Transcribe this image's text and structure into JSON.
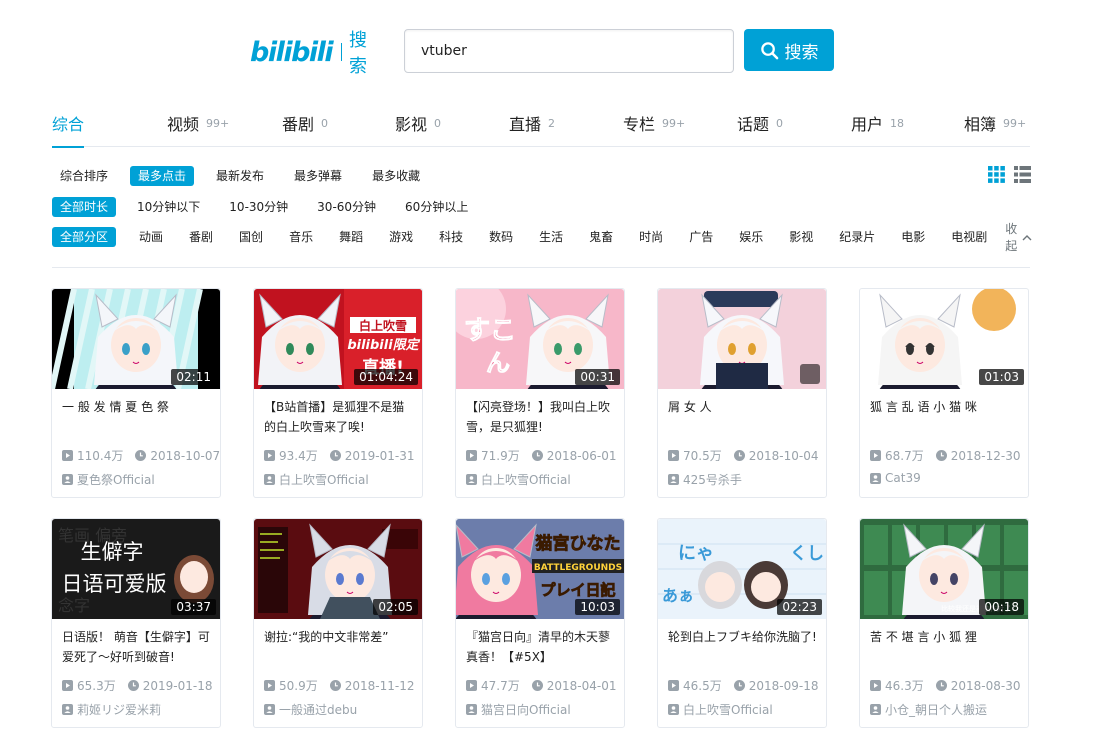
{
  "header": {
    "logo_text": "bilibili",
    "logo_sub": "搜索",
    "search_value": "vtuber",
    "search_button": "搜索"
  },
  "type_tabs": [
    {
      "label": "综合",
      "count": ""
    },
    {
      "label": "视频",
      "count": "99+"
    },
    {
      "label": "番剧",
      "count": "0"
    },
    {
      "label": "影视",
      "count": "0"
    },
    {
      "label": "直播",
      "count": "2"
    },
    {
      "label": "专栏",
      "count": "99+"
    },
    {
      "label": "话题",
      "count": "0"
    },
    {
      "label": "用户",
      "count": "18"
    },
    {
      "label": "相簿",
      "count": "99+"
    }
  ],
  "active_tab": "综合",
  "order_filters": [
    "综合排序",
    "最多点击",
    "最新发布",
    "最多弹幕",
    "最多收藏"
  ],
  "order_selected": "最多点击",
  "duration_filters": [
    "全部时长",
    "10分钟以下",
    "10-30分钟",
    "30-60分钟",
    "60分钟以上"
  ],
  "duration_selected": "全部时长",
  "zone_filters": [
    "全部分区",
    "动画",
    "番剧",
    "国创",
    "音乐",
    "舞蹈",
    "游戏",
    "科技",
    "数码",
    "生活",
    "鬼畜",
    "时尚",
    "广告",
    "娱乐",
    "影视",
    "纪录片",
    "电影",
    "电视剧"
  ],
  "zone_selected": "全部分区",
  "collapse_label": "收起",
  "colors": {
    "accent": "#00a1d6",
    "meta": "#99a2aa",
    "border": "#e5e9ef"
  },
  "videos": [
    {
      "title": "一 般 发 情 夏 色 祭",
      "duration": "02:11",
      "views": "110.4万",
      "date": "2018-10-07",
      "uploader": "夏色祭Official",
      "thumb_text": ""
    },
    {
      "title": "【B站首播】是狐狸不是猫的白上吹雪来了唉!",
      "duration": "01:04:24",
      "views": "93.4万",
      "date": "2019-01-31",
      "uploader": "白上吹雪Official",
      "thumb_text": "白上吹雪 bilibili限定 直播!"
    },
    {
      "title": "【闪亮登场！】我叫白上吹雪，是只狐狸!",
      "duration": "00:31",
      "views": "71.9万",
      "date": "2018-06-01",
      "uploader": "白上吹雪Official",
      "thumb_text": "すこん"
    },
    {
      "title": "屑 女 人",
      "duration": "",
      "views": "70.5万",
      "date": "2018-10-04",
      "uploader": "425号杀手",
      "thumb_text": ""
    },
    {
      "title": "狐 言 乱 语 小 猫 咪",
      "duration": "01:03",
      "views": "68.7万",
      "date": "2018-12-30",
      "uploader": "Cat39",
      "thumb_text": ""
    },
    {
      "title": "日语版！ 萌音【生僻字】可爱死了～好听到破音!",
      "duration": "03:37",
      "views": "65.3万",
      "date": "2019-01-18",
      "uploader": "莉姬リジ爱米莉",
      "thumb_text": "生僻字 日语可爱版"
    },
    {
      "title": "谢拉:“我的中文非常差”",
      "duration": "02:05",
      "views": "50.9万",
      "date": "2018-11-12",
      "uploader": "一般通过debu",
      "thumb_text": ""
    },
    {
      "title": "『猫宫日向』清早的木天蓼真香！【#5X】",
      "duration": "10:03",
      "views": "47.7万",
      "date": "2018-04-01",
      "uploader": "猫宫日向Official",
      "thumb_text": "猫宫ひなた BATTLEGROUNDS プレイ日記"
    },
    {
      "title": "轮到白上フブキ给你洗脑了!",
      "duration": "02:23",
      "views": "46.5万",
      "date": "2018-09-18",
      "uploader": "白上吹雪Official",
      "thumb_text": "にゃあぁ くしゅ"
    },
    {
      "title": "苦 不 堪 言 小 狐 狸",
      "duration": "00:18",
      "views": "46.3万",
      "date": "2018-08-30",
      "uploader": "小仓_朝日个人搬运",
      "thumb_text": ""
    }
  ]
}
